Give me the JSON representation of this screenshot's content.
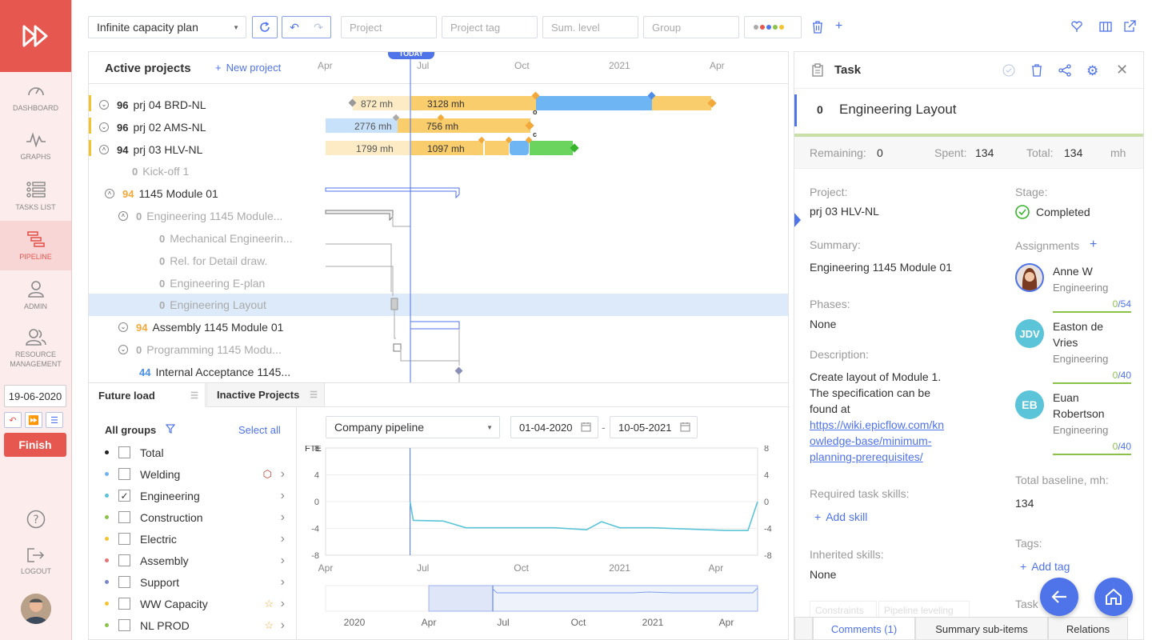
{
  "nav": {
    "items": [
      {
        "label": "DASHBOARD"
      },
      {
        "label": "GRAPHS"
      },
      {
        "label": "TASKS LIST"
      },
      {
        "label": "PIPELINE"
      },
      {
        "label": "ADMIN"
      },
      {
        "label": "RESOURCE MANAGEMENT"
      }
    ],
    "date": "19-06-2020",
    "finish": "Finish",
    "logout": "LOGOUT"
  },
  "toolbar": {
    "plan": "Infinite capacity plan",
    "project_ph": "Project",
    "tag_ph": "Project tag",
    "sum_ph": "Sum. level",
    "group_ph": "Group"
  },
  "gantt": {
    "title": "Active projects",
    "new_project": "New project",
    "today": "TODAY",
    "months": [
      "Apr",
      "Jul",
      "Oct",
      "2021",
      "Apr"
    ],
    "rows": [
      {
        "num": "96",
        "name": "prj 04 BRD-NL"
      },
      {
        "num": "96",
        "name": "prj 02 AMS-NL"
      },
      {
        "num": "94",
        "name": "prj 03 HLV-NL"
      },
      {
        "num": "0",
        "name": "Kick-off 1"
      },
      {
        "num": "94",
        "name": "1145 Module 01"
      },
      {
        "num": "0",
        "name": "Engineering 1145 Module..."
      },
      {
        "num": "0",
        "name": "Mechanical Engineerin..."
      },
      {
        "num": "0",
        "name": "Rel. for Detail draw."
      },
      {
        "num": "0",
        "name": "Engineering E-plan"
      },
      {
        "num": "0",
        "name": "Engineering Layout"
      },
      {
        "num": "94",
        "name": "Assembly 1145 Module 01"
      },
      {
        "num": "0",
        "name": "Programming 1145 Modu..."
      },
      {
        "num": "44",
        "name": "Internal Acceptance 1145..."
      }
    ],
    "bar_labels": [
      "872 mh",
      "3128 mh",
      "2776 mh",
      "756 mh",
      "1799 mh",
      "1097 mh"
    ],
    "markers": [
      "o",
      "c"
    ]
  },
  "bottom": {
    "tab1": "Future load",
    "tab2": "Inactive Projects",
    "all_groups": "All groups",
    "select_all": "Select all",
    "groups": [
      {
        "name": "Total",
        "color": "#222222",
        "checked": false
      },
      {
        "name": "Welding",
        "color": "#6fb3f2",
        "checked": false
      },
      {
        "name": "Engineering",
        "color": "#5bc4d8",
        "checked": true
      },
      {
        "name": "Construction",
        "color": "#8bc34a",
        "checked": false
      },
      {
        "name": "Electric",
        "color": "#f4c430",
        "checked": false
      },
      {
        "name": "Assembly",
        "color": "#e57373",
        "checked": false
      },
      {
        "name": "Support",
        "color": "#7986cb",
        "checked": false
      },
      {
        "name": "WW Capacity",
        "color": "#f4c430",
        "checked": false
      },
      {
        "name": "NL PROD",
        "color": "#8bc34a",
        "checked": false
      }
    ],
    "pipeline_select": "Company pipeline",
    "date_from": "01-04-2020",
    "date_to": "10-05-2021",
    "date_sep": "-"
  },
  "chart_data": {
    "type": "line",
    "ylabel": "FTE",
    "ylim": [
      -8,
      8
    ],
    "yticks": [
      "8",
      "4",
      "0",
      "-4",
      "-8"
    ],
    "xticks": [
      "Apr",
      "Jul",
      "Oct",
      "2021",
      "Apr"
    ],
    "nav_ticks": [
      "2020",
      "Apr",
      "Jul",
      "Oct",
      "2021",
      "Apr"
    ],
    "series": [
      {
        "color": "#5bc4d8",
        "x": [
          "2020-06-19",
          "2020-06-22",
          "2020-07-20",
          "2020-08-10",
          "2020-11-01",
          "2020-12-01",
          "2020-12-15",
          "2021-01-01",
          "2021-02-01",
          "2021-04-10",
          "2021-05-01",
          "2021-05-10"
        ],
        "y": [
          0,
          -2.8,
          -2.9,
          -3.9,
          -3.9,
          -4.2,
          -3.0,
          -3.9,
          -3.9,
          -4.3,
          -4.3,
          0
        ]
      }
    ]
  },
  "task": {
    "header": "Task",
    "num": "0",
    "title": "Engineering Layout",
    "remaining_lbl": "Remaining:",
    "remaining": "0",
    "spent_lbl": "Spent:",
    "spent": "134",
    "total_lbl": "Total:",
    "total": "134",
    "unit": "mh",
    "project_lbl": "Project:",
    "project": "prj 03 HLV-NL",
    "stage_lbl": "Stage:",
    "stage": "Completed",
    "summary_lbl": "Summary:",
    "summary": "Engineering 1145 Module 01",
    "assign_lbl": "Assignments",
    "phases_lbl": "Phases:",
    "phases": "None",
    "desc_lbl": "Description:",
    "desc_l1": "Create layout of Module 1.",
    "desc_l2": "The specification can be",
    "desc_l3": "found at",
    "desc_link1": "https://wiki.epicflow.com/kn",
    "desc_link2": "owledge-base/minimum-",
    "desc_link3": "planning-prerequisites/",
    "skills_lbl": "Required task skills:",
    "add_skill": "Add skill",
    "inh_lbl": "Inherited skills:",
    "inh": "None",
    "baseline_lbl": "Total baseline, mh:",
    "baseline": "134",
    "tags_lbl": "Tags:",
    "add_tag": "Add tag",
    "task_lbl": "Task",
    "ghost_tab1": "Constraints",
    "ghost_tab2": "Pipeline leveling",
    "assignments": [
      {
        "name": "Anne W",
        "dept": "Engineering",
        "done": "0",
        "total": "/54",
        "initials": ""
      },
      {
        "name1": "Easton de",
        "name2": "Vries",
        "dept": "Engineering",
        "done": "0",
        "total": "/40",
        "initials": "JDV"
      },
      {
        "name1": "Euan",
        "name2": "Robertson",
        "dept": "Engineering",
        "done": "0",
        "total": "/40",
        "initials": "EB"
      }
    ],
    "tabs": [
      "Comments (1)",
      "Summary sub-items",
      "Relations"
    ]
  }
}
